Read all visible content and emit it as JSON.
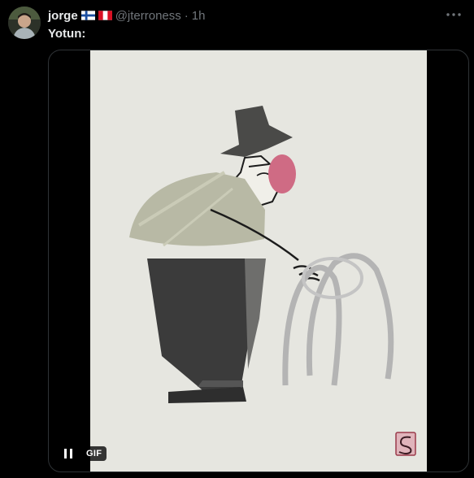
{
  "post": {
    "author_name": "jorge",
    "flags": [
      "finland-flag",
      "peru-flag"
    ],
    "handle": "@jterroness",
    "separator": "·",
    "time": "1h",
    "text": "Yotun:"
  },
  "media": {
    "type": "gif",
    "gif_label": "GIF",
    "art_background": "#e6e6e0"
  },
  "icons": {
    "more": "more-options-icon",
    "pause": "pause-icon"
  },
  "colors": {
    "background": "#000000",
    "primary_text": "#e7e9ea",
    "secondary_text": "#71767b"
  }
}
